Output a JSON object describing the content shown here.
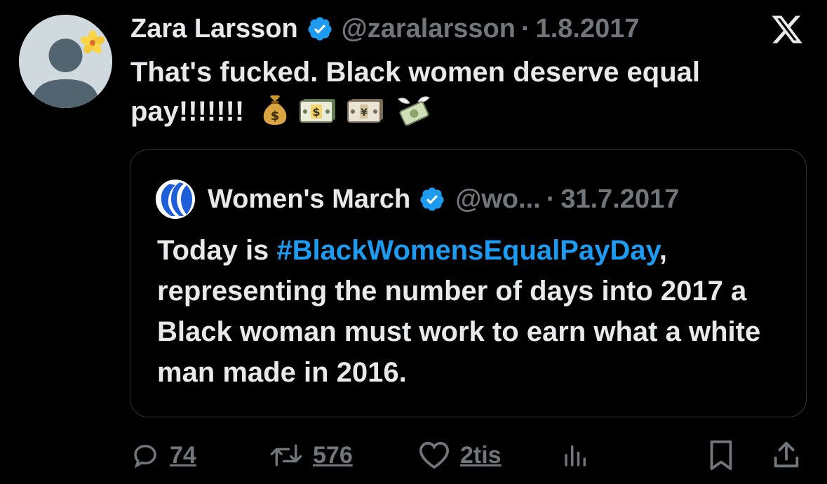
{
  "author": {
    "name": "Zara Larsson",
    "handle": "@zaralarsson",
    "separator": "·",
    "date": "1.8.2017",
    "verified": true,
    "avatar_icon": "default-profile-with-flower-icon"
  },
  "tweet": {
    "text": "That's fucked. Black women deserve equal pay!!!!!!!",
    "emojis": [
      "money-bag-icon",
      "dollar-banknote-icon",
      "yen-banknote-icon",
      "money-with-wings-icon"
    ]
  },
  "quote": {
    "name": "Women's March",
    "handle": "@wo...",
    "separator": "·",
    "date": "31.7.2017",
    "verified": true,
    "text_before": "Today is ",
    "hashtag": "#BlackWomensEqualPayDay",
    "text_after": ", representing the number of days into 2017 a Black woman must work to earn what a white man made in 2016."
  },
  "actions": {
    "replies": "74",
    "reposts": "576",
    "likes": "2tis"
  },
  "colors": {
    "background": "#000000",
    "text": "#e7e9ea",
    "muted": "#71767b",
    "accent": "#1d9bf0",
    "border": "#2f3336"
  }
}
